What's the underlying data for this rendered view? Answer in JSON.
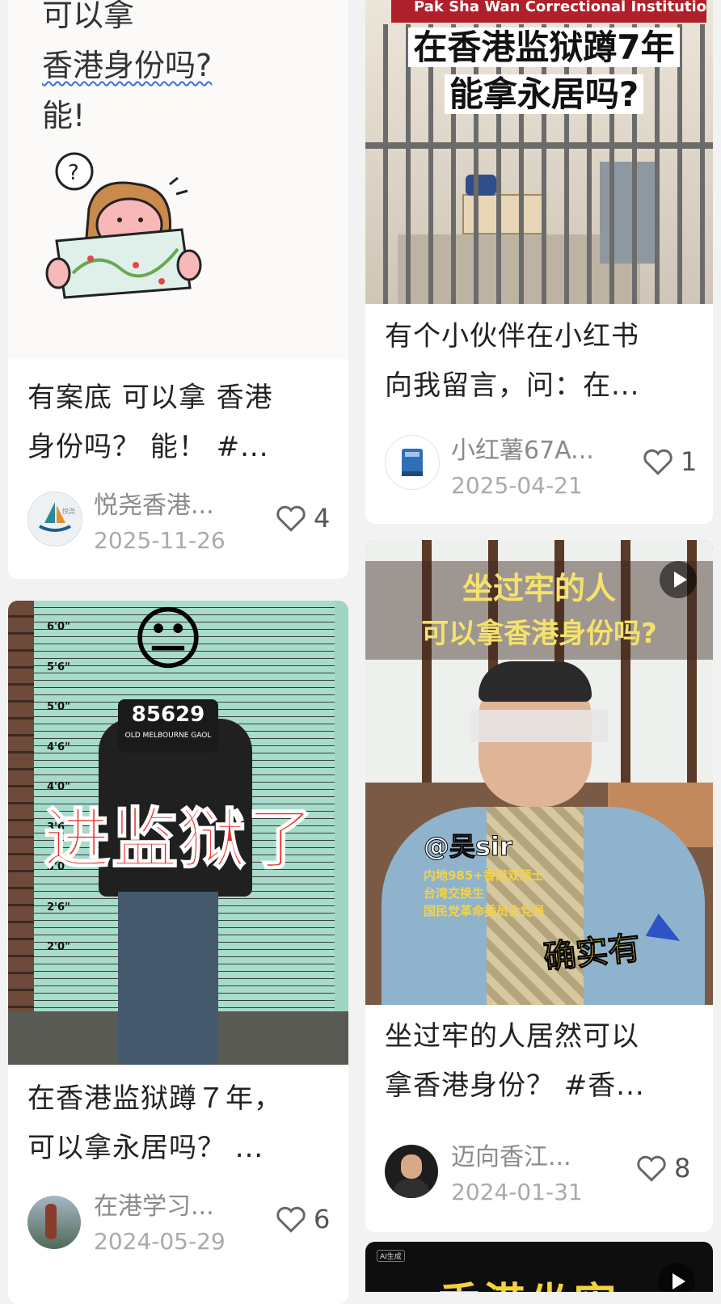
{
  "colors": {
    "background": "#f2f2f2",
    "card": "#ffffff",
    "text": "#222222",
    "meta": "#aaaaaa"
  },
  "posts": [
    {
      "cover_lines": [
        "可以拿",
        "香港身份吗?",
        "能!"
      ],
      "title_lines": [
        "有案底 可以拿 香港",
        "身份吗？ 能！ #..."
      ],
      "author": "悦尧香港...",
      "date": "2025-11-26",
      "likes": "4",
      "avatar_label": "悦尧"
    },
    {
      "cover_banner": "Pak Sha Wan Correctional Institution",
      "cover_lines": [
        "在香港监狱蹲7年",
        "能拿永居吗?"
      ],
      "title_lines": [
        "有个小伙伴在小红书",
        "向我留言，问：在..."
      ],
      "author": "小红薯67A...",
      "date": "2025-04-21",
      "likes": "1"
    },
    {
      "cover_plate": "85629",
      "cover_plate_sub": "OLD MELBOURNE GAOL",
      "cover_heights": [
        "6'0\"",
        "5'6\"",
        "5'0\"",
        "4'6\"",
        "4'0\"",
        "3'6\"",
        "3'0\"",
        "2'6\"",
        "2'0\""
      ],
      "cover_caption": "进监狱了",
      "cover_emoji": "😐",
      "title_lines": [
        "在香港监狱蹲７年，",
        "可以拿永居吗？ ..."
      ],
      "author": "在港学习...",
      "date": "2024-05-29",
      "likes": "6"
    },
    {
      "cover_lines": [
        "坐过牢的人",
        "可以拿香港身份吗?"
      ],
      "cover_name_tag": "@吴sir",
      "cover_bio": [
        "内地985+香港双硕士",
        "台湾交换生",
        "国民党革命委员会党员"
      ],
      "cover_caption": "确实有",
      "title_lines": [
        "坐过牢的人居然可以",
        "拿香港身份？ #香..."
      ],
      "author": "迈向香江...",
      "date": "2024-01-31",
      "likes": "8"
    },
    {
      "cover_badge": "AI生成",
      "cover_title": "香港坐牢"
    }
  ]
}
